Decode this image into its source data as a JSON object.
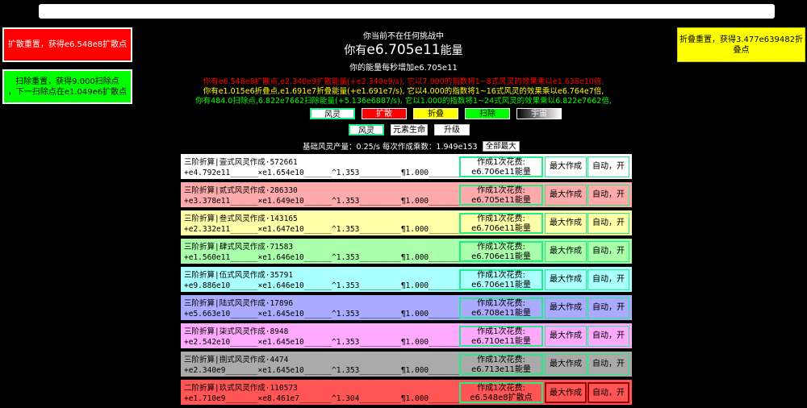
{
  "side": {
    "diffuse_reset": "扩散重置，获得e6.548e8扩散点",
    "sweep_reset_line1": "扫除重置，获得9.000扫除点",
    "sweep_reset_line2": "，下一扫除点在e1.049e6扩散点",
    "fold_reset": "折叠重置，获得3.477e639482折叠点"
  },
  "status": {
    "challenge": "你当前不在任何挑战中",
    "energy_prefix": "你有",
    "energy_value": "e6.705e11",
    "energy_suffix": "能量",
    "rate": "你的能量每秒增加e6.705e11"
  },
  "info": {
    "line1": "你有e6.548e8扩散点,e2.340e9扩散能量(+e2.340e9/s), 它以7.000的指数将1~8式风灵的效果乘以e1.638e10倍,",
    "line2": "你有e1.015e6折叠点,e1.691e7折叠能量(+e1.691e7/s), 它以4.000的指数将1~16式风灵的效果乘以e6.764e7倍,",
    "line3": "你有484.0扫除点,6.822e7662扫除能量(+5.136e6887/s), 它以1.000的指数将1~24式风灵的效果乘以6.822e7662倍,"
  },
  "tabs": {
    "wind": "风灵",
    "diffuse": "扩散",
    "fold": "折叠",
    "sweep": "扫除",
    "other": "宇宙"
  },
  "subtabs": {
    "wind": "风灵",
    "element": "元素生命",
    "upgrade": "升级"
  },
  "base": {
    "prefix": "基础风灵产量：",
    "value": "0.25/s",
    "mult_prefix": "每次作成乘数：",
    "mult_value": "1.949e153",
    "max_all": "全部最大"
  },
  "rows": [
    {
      "line1": "三阶折算|壹式风灵作成·572661",
      "line2": "+e4.792e11______×e1.654e10______^1.353_________¶1.000_________",
      "cost_label": "作成1次花费:",
      "cost_value": "e6.706e11能量",
      "max": "最大作成",
      "auto": "自动，开",
      "bg": "#ffffff"
    },
    {
      "line1": "三阶折算|贰式风灵作成·286330",
      "line2": "+e3.378e11______×e1.649e10______^1.353_________¶1.000_________",
      "cost_label": "作成1次花费:",
      "cost_value": "e6.705e11能量",
      "max": "最大作成",
      "auto": "自动，开",
      "bg": "#ffaaaa"
    },
    {
      "line1": "三阶折算|叁式风灵作成·143165",
      "line2": "+e2.332e11______×e1.647e10______^1.353_________¶1.000_________",
      "cost_label": "作成1次花费:",
      "cost_value": "e6.706e11能量",
      "max": "最大作成",
      "auto": "自动，开",
      "bg": "#ffffaa"
    },
    {
      "line1": "三阶折算|肆式风灵作成·71583",
      "line2": "+e1.560e11______×e1.646e10______^1.353_________¶1.000_________",
      "cost_label": "作成1次花费:",
      "cost_value": "e6.706e11能量",
      "max": "最大作成",
      "auto": "自动，开",
      "bg": "#aaffaa"
    },
    {
      "line1": "三阶折算|伍式风灵作成·35791",
      "line2": "+e9.886e10______×e1.646e10______^1.353_________¶1.000_________",
      "cost_label": "作成1次花费:",
      "cost_value": "e6.706e11能量",
      "max": "最大作成",
      "auto": "自动，开",
      "bg": "#aaffff"
    },
    {
      "line1": "三阶折算|陆式风灵作成·17896",
      "line2": "+e5.663e10______×e1.645e10______^1.353_________¶1.000_________",
      "cost_label": "作成1次花费:",
      "cost_value": "e6.708e11能量",
      "max": "最大作成",
      "auto": "自动，开",
      "bg": "#aaaaff"
    },
    {
      "line1": "三阶折算|柒式风灵作成·8948",
      "line2": "+e2.542e10______×e1.645e10______^1.353_________¶1.000_________",
      "cost_label": "作成1次花费:",
      "cost_value": "e6.710e11能量",
      "max": "最大作成",
      "auto": "自动，开",
      "bg": "#ffaaff"
    },
    {
      "line1": "三阶折算|捌式风灵作成·4474",
      "line2": "+e2.340e9_______×e1.645e10______^1.353_________¶1.000_________",
      "cost_label": "作成1次花费:",
      "cost_value": "e6.713e11能量",
      "max": "最大作成",
      "auto": "自动，开",
      "bg": "#aaaaaa"
    },
    {
      "line1": "二阶折算|玖式风灵作成·110573",
      "line2": "+e1.710e9_______×e8.461e7_______^1.304_________¶1.000_________",
      "cost_label": "作成1次花费:",
      "cost_value": "e6.548e8扩散点",
      "max": "最大作成",
      "auto": "自动，开",
      "bg": "#ff5555",
      "red_buttons": true
    }
  ]
}
